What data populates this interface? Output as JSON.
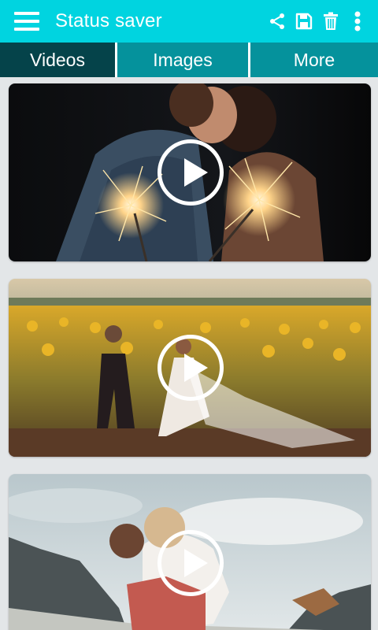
{
  "appbar": {
    "title": "Status saver",
    "icons": [
      "menu-icon",
      "share-icon",
      "save-icon",
      "delete-icon",
      "more-vert-icon"
    ],
    "color": "#00d4e0"
  },
  "tabs": [
    {
      "label": "Videos",
      "selected": true
    },
    {
      "label": "Images",
      "selected": false
    },
    {
      "label": "More",
      "selected": false
    }
  ],
  "colors": {
    "tab_selected": "#05434a",
    "tab_default": "#05929c",
    "background": "#e3e6e8"
  },
  "videos": [
    {
      "thumbnail": "couple-kissing-with-sparklers",
      "icon": "play-icon"
    },
    {
      "thumbnail": "wedding-couple-in-sunflower-field",
      "icon": "play-icon"
    },
    {
      "thumbnail": "couple-hugging-mountain-landscape",
      "icon": "play-icon"
    }
  ]
}
